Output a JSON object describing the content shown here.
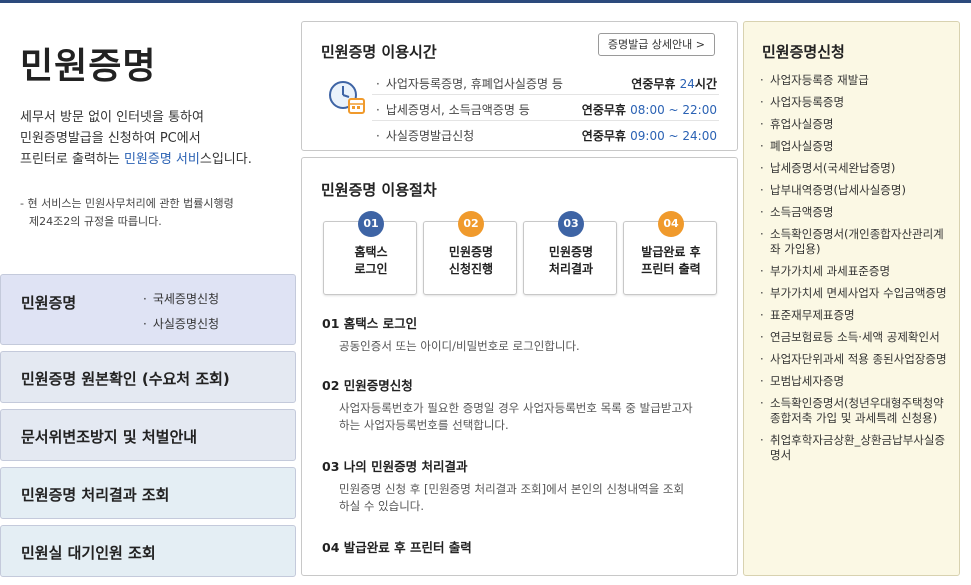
{
  "left": {
    "title": "민원증명",
    "desc_line1": "세무서 방문 없이 인터넷을 통하여",
    "desc_line2": "민원증명발급을 신청하여 PC에서",
    "desc_line3_pre": "프린터로 출력하는 ",
    "desc_line3_hl": "민원증명 서비",
    "desc_line3_post": "스입니다.",
    "note_line1": "- 현 서비스는 민원사무처리에 관한 법률시행령",
    "note_line2": "제24조2의 규정을 따릅니다.",
    "menu": {
      "item1": "민원증명",
      "item1_sub1": "국세증명신청",
      "item1_sub2": "사실증명신청",
      "item2": "민원증명 원본확인 (수요처 조회)",
      "item3": "문서위변조방지 및 처벌안내",
      "item4": "민원증명 처리결과 조회",
      "item5": "민원실 대기인원 조회"
    }
  },
  "hours": {
    "title": "민원증명 이용시간",
    "detail_button": "증명발급 상세안내 >",
    "rows": [
      {
        "label": "사업자등록증명, 휴폐업사실증명 등",
        "val_pre": "연중무휴 ",
        "val_blue": "24",
        "val_post": "시간"
      },
      {
        "label": "납세증명서, 소득금액증명 등",
        "val_pre": "연중무휴 ",
        "val_blue": "08:00 ~ 22:00",
        "val_post": ""
      },
      {
        "label": "사실증명발급신청",
        "val_pre": "연중무휴 ",
        "val_blue": "09:00 ~ 24:00",
        "val_post": ""
      }
    ]
  },
  "procedure": {
    "title": "민원증명 이용절차",
    "steps": [
      {
        "num": "01",
        "line1": "홈택스",
        "line2": "로그인"
      },
      {
        "num": "02",
        "line1": "민원증명",
        "line2": "신청진행"
      },
      {
        "num": "03",
        "line1": "민원증명",
        "line2": "처리결과"
      },
      {
        "num": "04",
        "line1": "발급완료 후",
        "line2": "프린터 출력"
      }
    ],
    "sections": [
      {
        "head": "01 홈택스 로그인",
        "body1": "공동인증서 또는 아이디/비밀번호로 로그인합니다.",
        "body2": ""
      },
      {
        "head": "02 민원증명신청",
        "body1": "사업자등록번호가 필요한 증명일 경우 사업자등록번호 목록 중 발급받고자",
        "body2": "하는 사업자등록번호를 선택합니다."
      },
      {
        "head": "03 나의 민원증명 처리결과",
        "body1": "민원증명 신청 후 [민원증명 처리결과 조회]에서 본인의 신청내역을 조회",
        "body2": "하실 수 있습니다."
      },
      {
        "head": "04 발급완료 후 프린터 출력",
        "body1": "",
        "body2": ""
      }
    ]
  },
  "right": {
    "title": "민원증명신청",
    "items": [
      "사업자등록증 재발급",
      "사업자등록증명",
      "휴업사실증명",
      "폐업사실증명",
      "납세증명서(국세완납증명)",
      "납부내역증명(납세사실증명)",
      "소득금액증명",
      "소득확인증명서(개인종합자산관리계좌 가입용)",
      "부가가치세 과세표준증명",
      "부가가치세 면세사업자 수입금액증명",
      "표준재무제표증명",
      "연금보험료등 소득·세액 공제확인서",
      "사업자단위과세 적용 종된사업장증명",
      "모범납세자증명",
      "소득확인증명서(청년우대형주택청약종합저축 가입 및 과세특례 신청용)",
      "취업후학자금상환_상환금납부사실증명서"
    ]
  },
  "colors": {
    "accent_blue": "#2b62b4",
    "step_blue": "#3e64a5",
    "step_orange": "#f09a2c",
    "right_panel_bg": "#fbf8e4"
  }
}
